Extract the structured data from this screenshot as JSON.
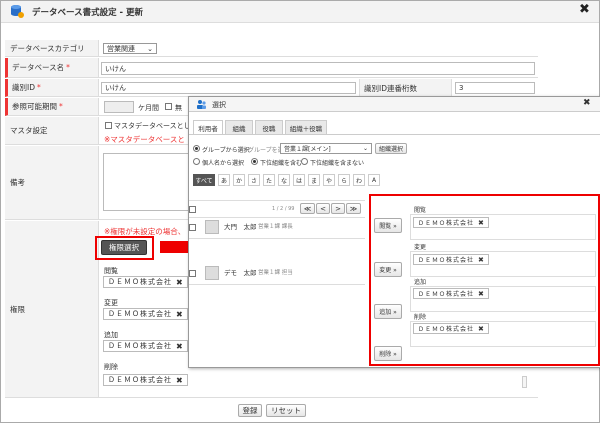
{
  "window": {
    "title": "データベース書式設定 - 更新",
    "close": "✖"
  },
  "form": {
    "category": {
      "label": "データベースカテゴリ",
      "value": "営業関連"
    },
    "db_name": {
      "label": "データベース名",
      "required": "*",
      "value": "いけん"
    },
    "id": {
      "label": "識別ID",
      "required": "*",
      "value": "いけん"
    },
    "id_digits": {
      "label": "識別ID連番桁数",
      "value": "3"
    },
    "ref_period": {
      "label": "参照可能期間",
      "required": "*",
      "unit": "ケ月間",
      "unlimited": "無"
    },
    "master": {
      "label": "マスタ設定",
      "checkbox": "マスタデータベースとして",
      "warning": "※マスタデータベースと"
    },
    "remarks": {
      "label": "備考"
    },
    "permission": {
      "label": "権限",
      "warning": "※権限が未設定の場合、",
      "select_button": "権限選択",
      "groups": [
        {
          "label": "閲覧",
          "chip": "ＤＥＭＯ株式会社"
        },
        {
          "label": "変更",
          "chip": "ＤＥＭＯ株式会社"
        },
        {
          "label": "追加",
          "chip": "ＤＥＭＯ株式会社"
        },
        {
          "label": "削除",
          "chip": "ＤＥＭＯ株式会社"
        }
      ]
    },
    "register": "登録",
    "reset": "リセット"
  },
  "dialog": {
    "title": "選択",
    "close": "✖",
    "tabs": [
      "利用者",
      "組織",
      "役職",
      "組織＋役職"
    ],
    "from_group": "グループから選択",
    "group_label": "グループを選択",
    "group_value": "営業１課[メイン]",
    "org_select_button": "組織選択",
    "from_person": "個人名から選択",
    "include_sub": "下位組織を含む",
    "exclude_sub": "下位組織を含まない",
    "kana": [
      "すべて",
      "あ",
      "か",
      "さ",
      "た",
      "な",
      "は",
      "ま",
      "や",
      "ら",
      "わ",
      "A"
    ],
    "pager": "1 / 2 / 99",
    "pager_buttons": [
      "≪",
      "<",
      ">",
      "≫"
    ],
    "people": [
      {
        "name": "大門　太郎",
        "dept": "営業１課 課長"
      },
      {
        "name": "デモ　太郎",
        "dept": "営業１課 担当"
      }
    ],
    "actions": [
      "閲覧 »",
      "変更 »",
      "追加 »",
      "削除 »"
    ],
    "selected": [
      {
        "label": "閲覧",
        "chip": "ＤＥＭＯ株式会社"
      },
      {
        "label": "変更",
        "chip": "ＤＥＭＯ株式会社"
      },
      {
        "label": "追加",
        "chip": "ＤＥＭＯ株式会社"
      },
      {
        "label": "削除",
        "chip": "ＤＥＭＯ株式会社"
      }
    ]
  },
  "colors": {
    "highlight": "#e00000",
    "required": "#e33333",
    "dialog_icon": "#1e6fc8"
  }
}
